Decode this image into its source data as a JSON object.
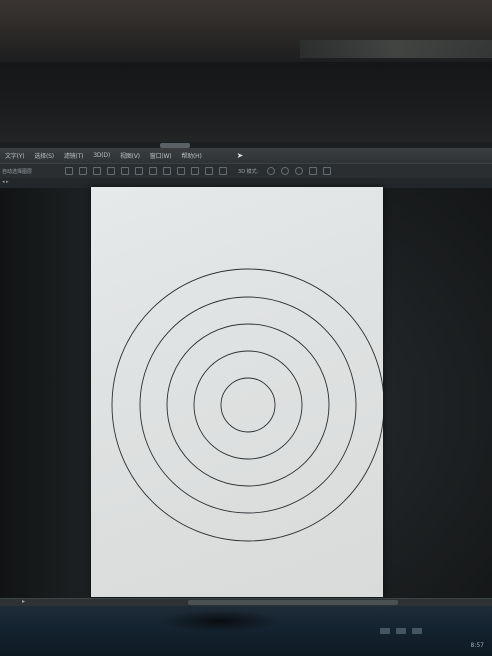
{
  "menu": {
    "items": [
      "文字(Y)",
      "选择(S)",
      "滤镜(T)",
      "3D(D)",
      "视图(V)",
      "窗口(W)",
      "帮助(H)"
    ]
  },
  "options_bar": {
    "auto_select_label": "自动选择图层",
    "mode_3d_label": "3D 模式:"
  },
  "canvas": {
    "background_color": "#e3e6e7",
    "stroke_color": "#2b2f33",
    "ring_count": 5
  },
  "taskbar": {
    "clock_text": "8:57"
  }
}
